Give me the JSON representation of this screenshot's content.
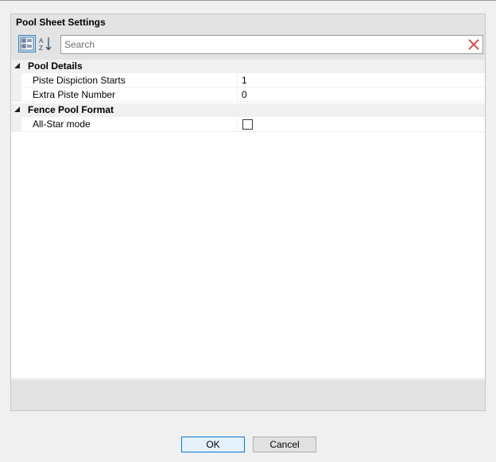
{
  "panel": {
    "title": "Pool Sheet Settings"
  },
  "toolbar": {
    "categorized_icon": "categorized-view-icon",
    "alphabetical_icon": "sort-alphabetical-icon"
  },
  "search": {
    "placeholder": "Search",
    "value": "",
    "clear_icon": "clear-x-icon",
    "clear_color": "#d9534f"
  },
  "grid": {
    "categories": [
      {
        "label": "Pool Details",
        "expanded": true,
        "properties": [
          {
            "name": "Piste Dispiction Starts",
            "value": "1"
          },
          {
            "name": "Extra Piste Number",
            "value": "0"
          }
        ]
      },
      {
        "label": "Fence Pool Format",
        "expanded": true,
        "properties": [
          {
            "name": "All-Star mode",
            "checked": false
          }
        ]
      }
    ]
  },
  "buttons": {
    "ok": "OK",
    "cancel": "Cancel"
  },
  "colors": {
    "accent": "#0078d7",
    "selected_tool_bg": "#cce4f7"
  }
}
